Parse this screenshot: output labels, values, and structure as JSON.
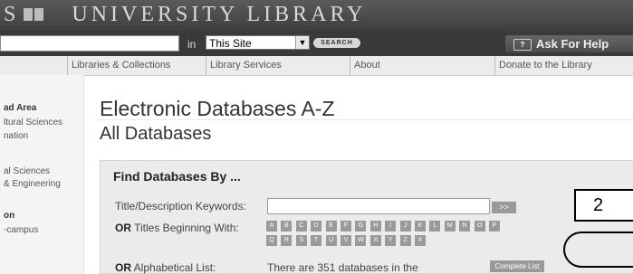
{
  "header": {
    "logo_text": "S",
    "library_text": "UNIVERSITY LIBRARY"
  },
  "search": {
    "in_label": "in",
    "scope_value": "This Site",
    "search_button": "SEARCH"
  },
  "ask": {
    "label": "Ask For Help",
    "icon": "chat-bubble-icon",
    "icon_glyph": "?"
  },
  "nav": {
    "items": [
      "Libraries & Collections",
      "Library Services",
      "About",
      "Donate to the Library"
    ]
  },
  "sidebar": {
    "head_1": "ad Area",
    "links_1": [
      "ltural Sciences",
      "nation"
    ],
    "links_2": [
      "al Sciences",
      "& Engineering"
    ],
    "head_2": "on",
    "links_3": [
      "-campus"
    ]
  },
  "main": {
    "title": "Electronic Databases A-Z",
    "subtitle": "All Databases",
    "panel_title": "Find Databases By ...",
    "keyword_label": "Title/Description Keywords:",
    "go_button": ">>",
    "or_label": "OR",
    "titles_label": "Titles Beginning With:",
    "letters": [
      "A",
      "B",
      "C",
      "D",
      "E",
      "F",
      "G",
      "H",
      "I",
      "J",
      "K",
      "L",
      "M",
      "N",
      "O",
      "P",
      "Q",
      "R",
      "S",
      "T",
      "U",
      "V",
      "W",
      "X",
      "Y",
      "Z",
      "#"
    ],
    "alpha_label": "Alphabetical List:",
    "count_text": "There are 351 databases in the",
    "complete_button": "Complete List"
  },
  "annotation": {
    "number": "2"
  }
}
